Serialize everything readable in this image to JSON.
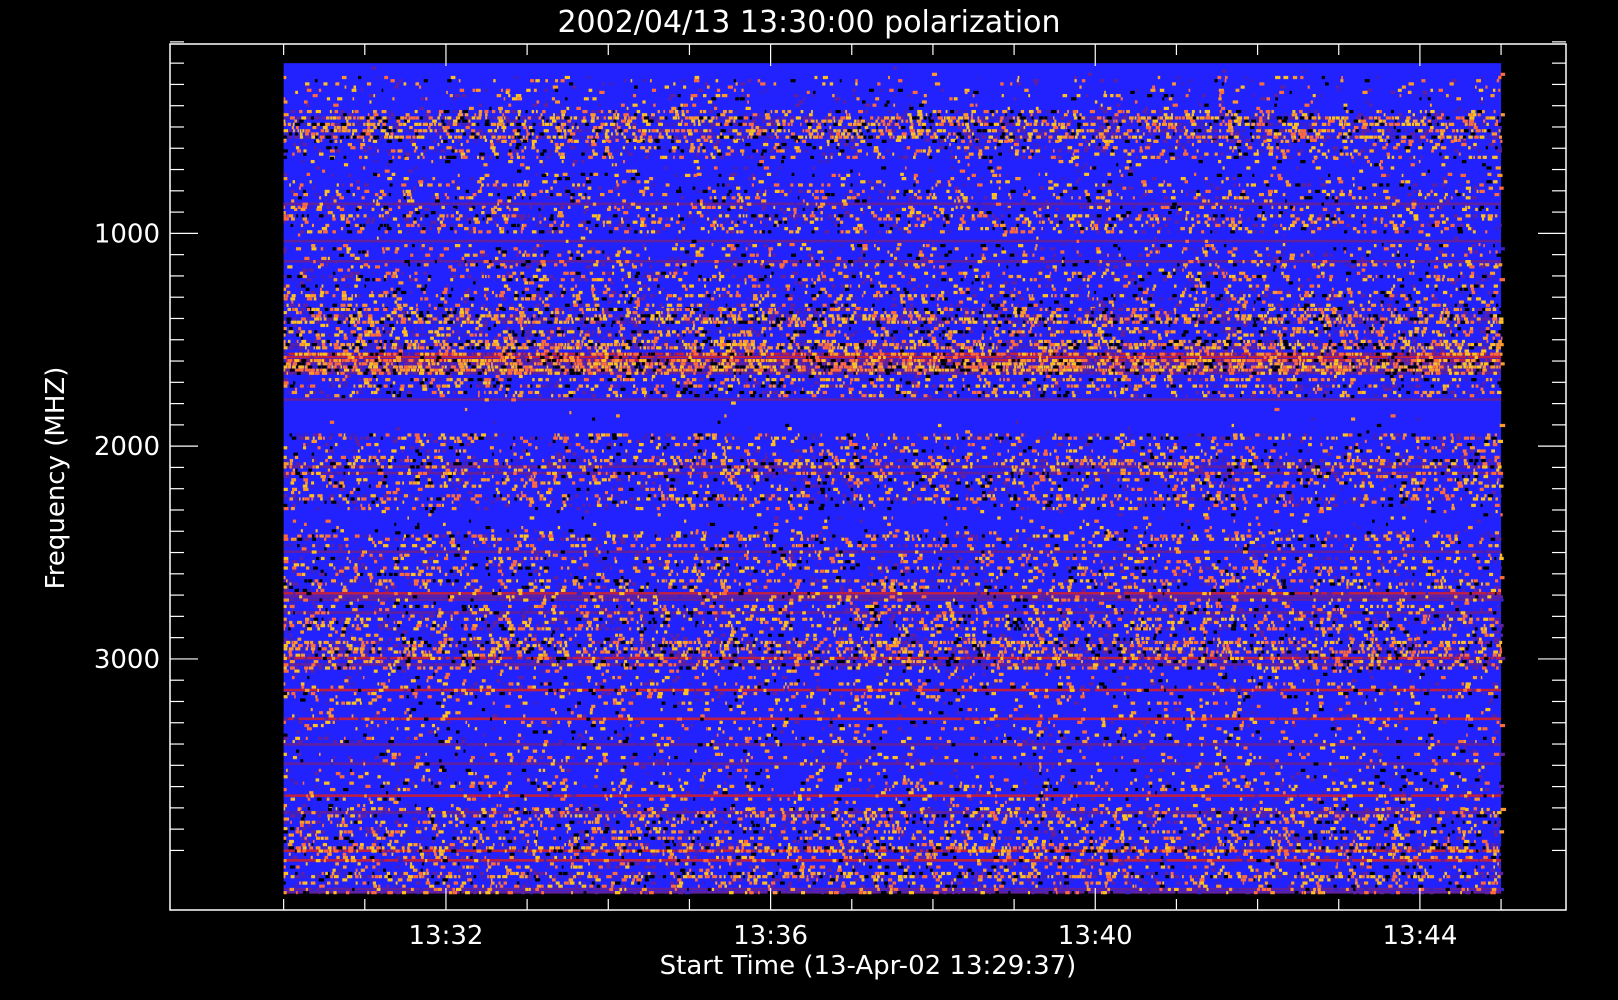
{
  "chart_data": {
    "type": "heatmap",
    "title": "2002/04/13 13:30:00 polarization",
    "xlabel": "Start Time (13-Apr-02 13:29:37)",
    "ylabel": "Frequency (MHZ)",
    "x_tick_labels": [
      "13:32",
      "13:36",
      "13:40",
      "13:44"
    ],
    "x_tick_minutes": [
      32,
      36,
      40,
      44
    ],
    "x_minor_tick_minutes": [
      30,
      31,
      32,
      33,
      34,
      35,
      36,
      37,
      38,
      39,
      40,
      41,
      42,
      43,
      44,
      45
    ],
    "xlim_minutes": [
      28.6,
      45.8
    ],
    "y_tick_labels": [
      "1000",
      "2000",
      "3000"
    ],
    "y_tick_values": [
      1000,
      2000,
      3000
    ],
    "y_minor_tick_values": [
      100,
      200,
      300,
      400,
      500,
      600,
      700,
      800,
      900,
      1000,
      1100,
      1200,
      1300,
      1400,
      1500,
      1600,
      1700,
      1800,
      1900,
      2000,
      2100,
      2200,
      2300,
      2400,
      2500,
      2600,
      2700,
      2800,
      2900,
      3000,
      3100,
      3200,
      3300,
      3400,
      3500,
      3600,
      3700,
      3800,
      3900
    ],
    "ylim": [
      4180,
      110
    ],
    "data_x_range_minutes": [
      30.0,
      45.0
    ],
    "data_y_range": [
      200,
      4100
    ],
    "colors": {
      "background": "#000000",
      "axes": "#ffffff",
      "base": "#2222ff",
      "palette": [
        "#2020f0",
        "#3a20c8",
        "#6020a0",
        "#ff9a2a",
        "#ffc020",
        "#ff6a3a",
        "#000000",
        "#c02040"
      ]
    },
    "bands": [
      {
        "y0": 200,
        "y1": 260,
        "level": 0.02
      },
      {
        "y0": 260,
        "y1": 330,
        "level": 0.35
      },
      {
        "y0": 330,
        "y1": 420,
        "level": 0.25
      },
      {
        "y0": 420,
        "y1": 560,
        "level": 0.7
      },
      {
        "y0": 560,
        "y1": 640,
        "level": 0.45
      },
      {
        "y0": 640,
        "y1": 720,
        "level": 0.15
      },
      {
        "y0": 720,
        "y1": 880,
        "level": 0.4
      },
      {
        "y0": 880,
        "y1": 1000,
        "level": 0.55
      },
      {
        "y0": 1000,
        "y1": 1050,
        "level": 0.08
      },
      {
        "y0": 1050,
        "y1": 1150,
        "level": 0.35
      },
      {
        "y0": 1150,
        "y1": 1350,
        "level": 0.45
      },
      {
        "y0": 1350,
        "y1": 1650,
        "level": 0.75
      },
      {
        "y0": 1650,
        "y1": 1760,
        "level": 0.55
      },
      {
        "y0": 1760,
        "y1": 1940,
        "level": 0.03
      },
      {
        "y0": 1940,
        "y1": 2300,
        "level": 0.55
      },
      {
        "y0": 2300,
        "y1": 2400,
        "level": 0.12
      },
      {
        "y0": 2400,
        "y1": 2900,
        "level": 0.5
      },
      {
        "y0": 2900,
        "y1": 3050,
        "level": 0.7
      },
      {
        "y0": 3050,
        "y1": 3700,
        "level": 0.3
      },
      {
        "y0": 3700,
        "y1": 4100,
        "level": 0.6
      }
    ]
  }
}
